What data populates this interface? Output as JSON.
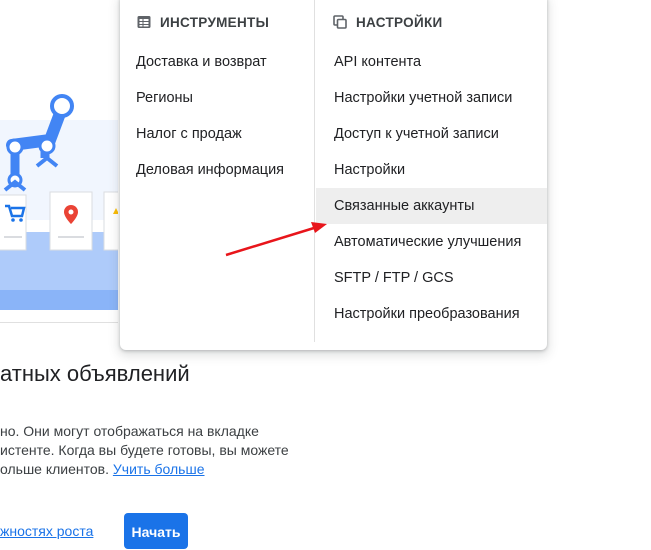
{
  "menu": {
    "tools": {
      "heading": "ИНСТРУМЕНТЫ",
      "icon": "table-icon",
      "items": [
        {
          "label": "Доставка и возврат"
        },
        {
          "label": "Регионы"
        },
        {
          "label": "Налог с продаж"
        },
        {
          "label": "Деловая информация"
        }
      ]
    },
    "settings": {
      "heading": "НАСТРОЙКИ",
      "icon": "copy-icon",
      "items": [
        {
          "label": "API контента"
        },
        {
          "label": "Настройки учетной записи"
        },
        {
          "label": "Доступ к учетной записи"
        },
        {
          "label": "Настройки"
        },
        {
          "label": "Связанные аккаунты",
          "highlighted": true
        },
        {
          "label": "Автоматические улучшения"
        },
        {
          "label": "SFTP / FTP / GCS"
        },
        {
          "label": "Настройки преобразования"
        }
      ]
    }
  },
  "page": {
    "heading": "атных объявлений",
    "description": {
      "line1": "но. Они могут отображаться на вкладке",
      "line2": "истенте. Когда вы будете готовы, вы можете",
      "line3": "ольше клиентов.",
      "link": "Учить больше"
    },
    "growth_link": "жностях роста",
    "start_button": "Начать"
  },
  "colors": {
    "accent": "#1a73e8",
    "highlight": "#eeeeee",
    "annotation_arrow": "#e8151b"
  }
}
